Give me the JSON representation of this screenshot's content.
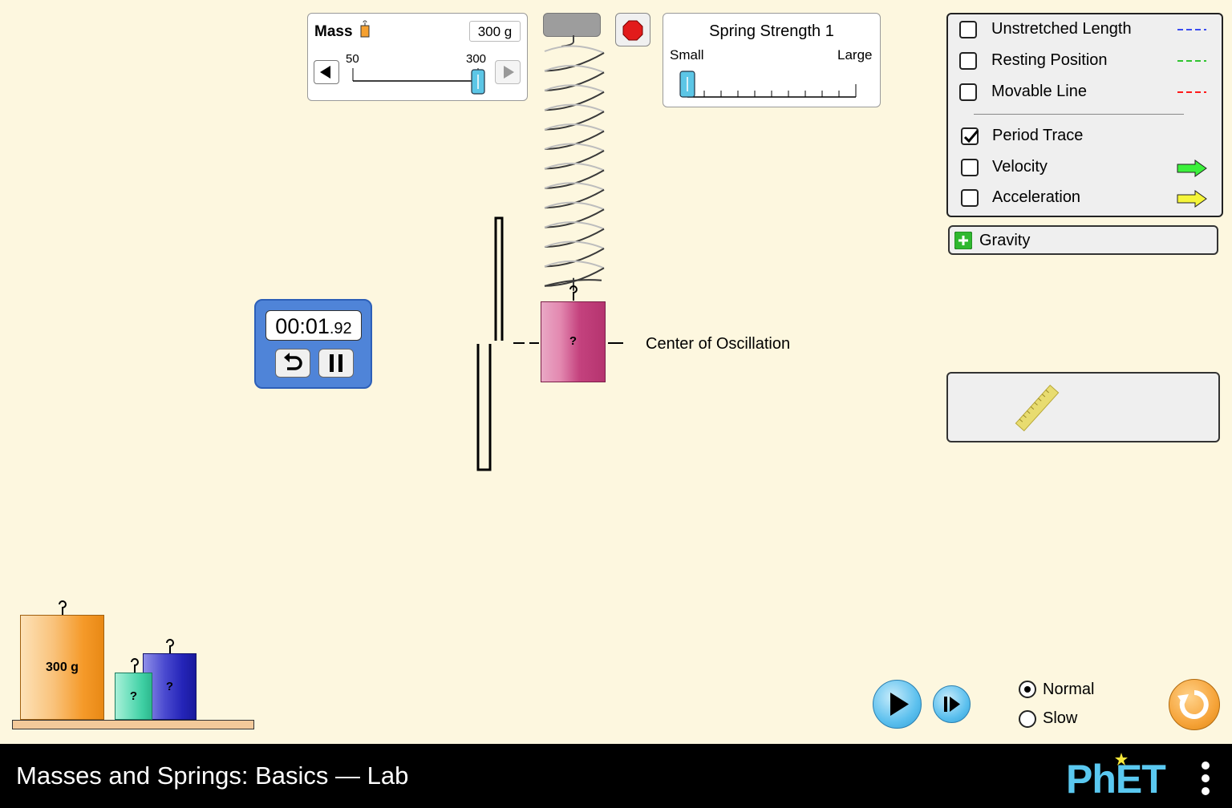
{
  "mass_panel": {
    "title": "Mass",
    "value": "300 g",
    "min_label": "50",
    "max_label": "300",
    "slider_fraction": 1.0
  },
  "spring_panel": {
    "title": "Spring Strength 1",
    "min_label": "Small",
    "max_label": "Large",
    "slider_fraction": 0.0
  },
  "options": {
    "items": [
      {
        "label": "Unstretched Length",
        "checked": false,
        "line_color": "#3b4cf0"
      },
      {
        "label": "Resting Position",
        "checked": false,
        "line_color": "#2fc42f"
      },
      {
        "label": "Movable Line",
        "checked": false,
        "line_color": "#ff1a1a"
      },
      {
        "label": "Period Trace",
        "checked": true
      },
      {
        "label": "Velocity",
        "checked": false,
        "arrow_color": "#3cf03c"
      },
      {
        "label": "Acceleration",
        "checked": false,
        "arrow_color": "#f5f53a"
      }
    ]
  },
  "gravity": {
    "label": "Gravity"
  },
  "stopwatch": {
    "time_main": "00:01",
    "time_frac": ".92"
  },
  "hanging_mass": {
    "label": "?",
    "color": "#c4427e"
  },
  "center_label": "Center of Oscillation",
  "shelf_masses": [
    {
      "label": "300 g",
      "color": "#f59a2a"
    },
    {
      "label": "?",
      "color": "#3ecfa3"
    },
    {
      "label": "?",
      "color": "#2424b8"
    }
  ],
  "speed": {
    "normal_label": "Normal",
    "slow_label": "Slow",
    "selected": "Normal"
  },
  "nav": {
    "title": "Masses and Springs: Basics — Lab",
    "logo": "PhET"
  },
  "colors": {
    "background": "#fdf7df",
    "accent_blue": "#4f84d8",
    "reset_orange": "#f39a1e"
  }
}
